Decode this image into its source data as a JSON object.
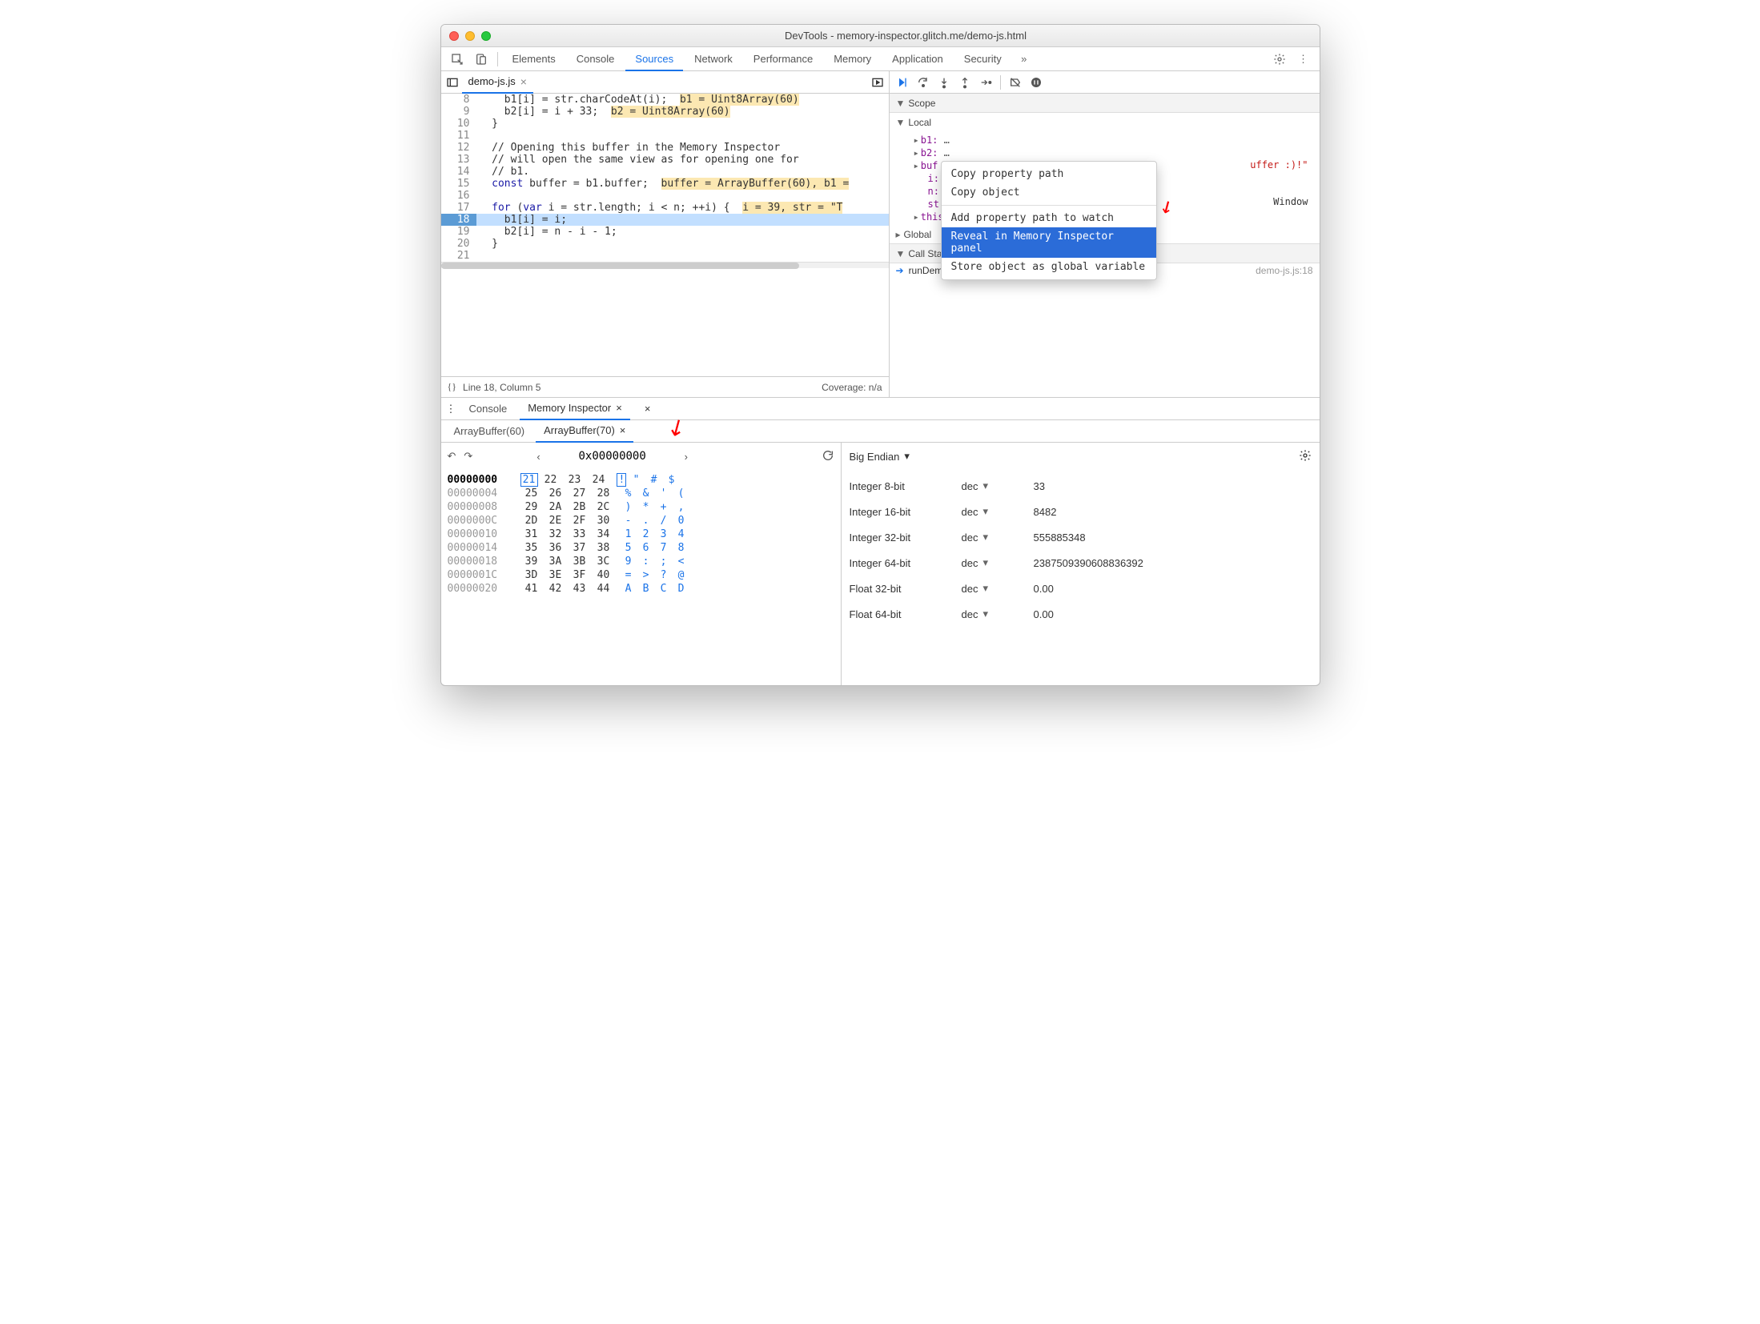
{
  "title": "DevTools - memory-inspector.glitch.me/demo-js.html",
  "top_tabs": [
    "Elements",
    "Console",
    "Sources",
    "Network",
    "Performance",
    "Memory",
    "Application",
    "Security"
  ],
  "top_tabs_active": "Sources",
  "file_tab": "demo-js.js",
  "code_lines": {
    "8": {
      "ln": "8",
      "txt": "    b1[i] = str.charCodeAt(i);  ",
      "ov": "b1 = Uint8Array(60)"
    },
    "9": {
      "ln": "9",
      "txt": "    b2[i] = i + 33;  ",
      "ov": "b2 = Uint8Array(60)"
    },
    "10": {
      "ln": "10",
      "txt": "  }"
    },
    "11": {
      "ln": "11",
      "txt": ""
    },
    "12": {
      "ln": "12",
      "txt": "  // Opening this buffer in the Memory Inspector",
      "cls": "cm"
    },
    "13": {
      "ln": "13",
      "txt": "  // will open the same view as for opening one for",
      "cls": "cm"
    },
    "14": {
      "ln": "14",
      "txt": "  // b1.",
      "cls": "cm"
    },
    "15": {
      "ln": "15",
      "txt": "  const buffer = b1.buffer;  ",
      "ov": "buffer = ArrayBuffer(60), b1 ="
    },
    "16": {
      "ln": "16",
      "txt": ""
    },
    "17": {
      "ln": "17",
      "txt": "  for (var i = str.length; i < n; ++i) {  ",
      "ov": "i = 39, str = \"T"
    },
    "18": {
      "ln": "18",
      "txt": "    b1[i] = i;",
      "active": true
    },
    "19": {
      "ln": "19",
      "txt": "    b2[i] = n - i - 1;"
    },
    "20": {
      "ln": "20",
      "txt": "  }"
    },
    "21": {
      "ln": "21",
      "txt": ""
    }
  },
  "status": {
    "left": "Line 18, Column 5",
    "right": "Coverage: n/a"
  },
  "scope": {
    "header": "Scope",
    "local": "Local",
    "rows": [
      {
        "k": "b1:",
        "v": "…"
      },
      {
        "k": "b2:",
        "v": "…"
      },
      {
        "k": "buf",
        "v": ""
      },
      {
        "k": "i:",
        "v": ""
      },
      {
        "k": "n:",
        "v": ""
      },
      {
        "k": "str",
        "v": ""
      },
      {
        "k": "this",
        "v": ""
      }
    ],
    "global": "Global",
    "global_right": "Window",
    "callstack": "Call Stack",
    "callstack_item": "runDemo",
    "callstack_loc": "demo-js.js:18",
    "str_tail": "uffer :)!\""
  },
  "ctxmenu": [
    "Copy property path",
    "Copy object",
    "Add property path to watch",
    "Reveal in Memory Inspector panel",
    "Store object as global variable"
  ],
  "ctxmenu_selected": "Reveal in Memory Inspector panel",
  "drawer_tabs": [
    "Console",
    "Memory Inspector"
  ],
  "drawer_tabs_active": "Memory Inspector",
  "drawer_subtabs": [
    "ArrayBuffer(60)",
    "ArrayBuffer(70)"
  ],
  "drawer_subtabs_active": "ArrayBuffer(70)",
  "mem_nav": {
    "address": "0x00000000"
  },
  "hex": {
    "rows": [
      {
        "a": "00000000",
        "b": [
          "21",
          "22",
          "23",
          "24"
        ],
        "c": [
          "!",
          "\"",
          "#",
          "$"
        ],
        "first": true
      },
      {
        "a": "00000004",
        "b": [
          "25",
          "26",
          "27",
          "28"
        ],
        "c": [
          "%",
          "&",
          "'",
          "("
        ]
      },
      {
        "a": "00000008",
        "b": [
          "29",
          "2A",
          "2B",
          "2C"
        ],
        "c": [
          ")",
          "*",
          "+",
          ","
        ]
      },
      {
        "a": "0000000C",
        "b": [
          "2D",
          "2E",
          "2F",
          "30"
        ],
        "c": [
          "-",
          ".",
          "/",
          "0"
        ]
      },
      {
        "a": "00000010",
        "b": [
          "31",
          "32",
          "33",
          "34"
        ],
        "c": [
          "1",
          "2",
          "3",
          "4"
        ]
      },
      {
        "a": "00000014",
        "b": [
          "35",
          "36",
          "37",
          "38"
        ],
        "c": [
          "5",
          "6",
          "7",
          "8"
        ]
      },
      {
        "a": "00000018",
        "b": [
          "39",
          "3A",
          "3B",
          "3C"
        ],
        "c": [
          "9",
          ":",
          ";",
          "<"
        ]
      },
      {
        "a": "0000001C",
        "b": [
          "3D",
          "3E",
          "3F",
          "40"
        ],
        "c": [
          "=",
          ">",
          "?",
          "@"
        ]
      },
      {
        "a": "00000020",
        "b": [
          "41",
          "42",
          "43",
          "44"
        ],
        "c": [
          "A",
          "B",
          "C",
          "D"
        ]
      }
    ]
  },
  "endian": "Big Endian",
  "types": [
    {
      "name": "Integer 8-bit",
      "fmt": "dec",
      "val": "33"
    },
    {
      "name": "Integer 16-bit",
      "fmt": "dec",
      "val": "8482"
    },
    {
      "name": "Integer 32-bit",
      "fmt": "dec",
      "val": "555885348"
    },
    {
      "name": "Integer 64-bit",
      "fmt": "dec",
      "val": "2387509390608836392"
    },
    {
      "name": "Float 32-bit",
      "fmt": "dec",
      "val": "0.00"
    },
    {
      "name": "Float 64-bit",
      "fmt": "dec",
      "val": "0.00"
    }
  ]
}
